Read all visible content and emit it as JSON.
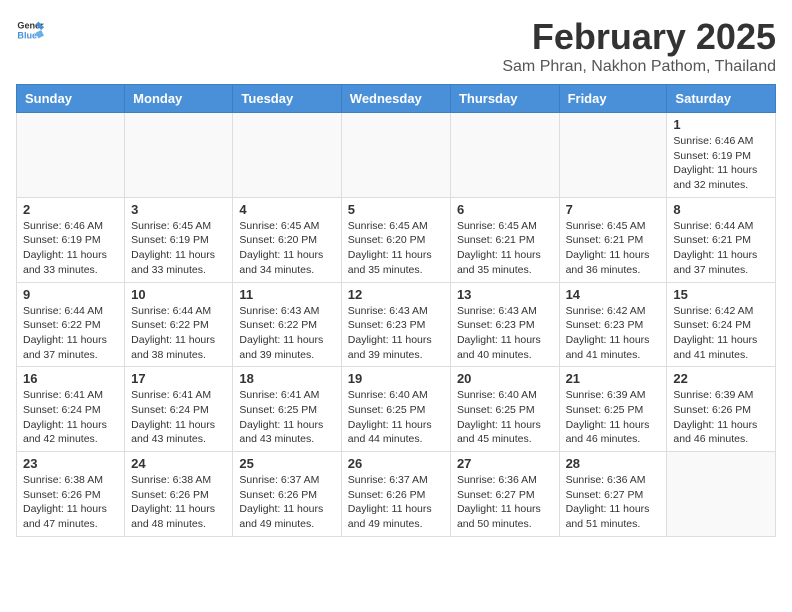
{
  "header": {
    "logo_general": "General",
    "logo_blue": "Blue",
    "title": "February 2025",
    "subtitle": "Sam Phran, Nakhon Pathom, Thailand"
  },
  "weekdays": [
    "Sunday",
    "Monday",
    "Tuesday",
    "Wednesday",
    "Thursday",
    "Friday",
    "Saturday"
  ],
  "weeks": [
    [
      {
        "day": "",
        "info": ""
      },
      {
        "day": "",
        "info": ""
      },
      {
        "day": "",
        "info": ""
      },
      {
        "day": "",
        "info": ""
      },
      {
        "day": "",
        "info": ""
      },
      {
        "day": "",
        "info": ""
      },
      {
        "day": "1",
        "info": "Sunrise: 6:46 AM\nSunset: 6:19 PM\nDaylight: 11 hours and 32 minutes."
      }
    ],
    [
      {
        "day": "2",
        "info": "Sunrise: 6:46 AM\nSunset: 6:19 PM\nDaylight: 11 hours and 33 minutes."
      },
      {
        "day": "3",
        "info": "Sunrise: 6:45 AM\nSunset: 6:19 PM\nDaylight: 11 hours and 33 minutes."
      },
      {
        "day": "4",
        "info": "Sunrise: 6:45 AM\nSunset: 6:20 PM\nDaylight: 11 hours and 34 minutes."
      },
      {
        "day": "5",
        "info": "Sunrise: 6:45 AM\nSunset: 6:20 PM\nDaylight: 11 hours and 35 minutes."
      },
      {
        "day": "6",
        "info": "Sunrise: 6:45 AM\nSunset: 6:21 PM\nDaylight: 11 hours and 35 minutes."
      },
      {
        "day": "7",
        "info": "Sunrise: 6:45 AM\nSunset: 6:21 PM\nDaylight: 11 hours and 36 minutes."
      },
      {
        "day": "8",
        "info": "Sunrise: 6:44 AM\nSunset: 6:21 PM\nDaylight: 11 hours and 37 minutes."
      }
    ],
    [
      {
        "day": "9",
        "info": "Sunrise: 6:44 AM\nSunset: 6:22 PM\nDaylight: 11 hours and 37 minutes."
      },
      {
        "day": "10",
        "info": "Sunrise: 6:44 AM\nSunset: 6:22 PM\nDaylight: 11 hours and 38 minutes."
      },
      {
        "day": "11",
        "info": "Sunrise: 6:43 AM\nSunset: 6:22 PM\nDaylight: 11 hours and 39 minutes."
      },
      {
        "day": "12",
        "info": "Sunrise: 6:43 AM\nSunset: 6:23 PM\nDaylight: 11 hours and 39 minutes."
      },
      {
        "day": "13",
        "info": "Sunrise: 6:43 AM\nSunset: 6:23 PM\nDaylight: 11 hours and 40 minutes."
      },
      {
        "day": "14",
        "info": "Sunrise: 6:42 AM\nSunset: 6:23 PM\nDaylight: 11 hours and 41 minutes."
      },
      {
        "day": "15",
        "info": "Sunrise: 6:42 AM\nSunset: 6:24 PM\nDaylight: 11 hours and 41 minutes."
      }
    ],
    [
      {
        "day": "16",
        "info": "Sunrise: 6:41 AM\nSunset: 6:24 PM\nDaylight: 11 hours and 42 minutes."
      },
      {
        "day": "17",
        "info": "Sunrise: 6:41 AM\nSunset: 6:24 PM\nDaylight: 11 hours and 43 minutes."
      },
      {
        "day": "18",
        "info": "Sunrise: 6:41 AM\nSunset: 6:25 PM\nDaylight: 11 hours and 43 minutes."
      },
      {
        "day": "19",
        "info": "Sunrise: 6:40 AM\nSunset: 6:25 PM\nDaylight: 11 hours and 44 minutes."
      },
      {
        "day": "20",
        "info": "Sunrise: 6:40 AM\nSunset: 6:25 PM\nDaylight: 11 hours and 45 minutes."
      },
      {
        "day": "21",
        "info": "Sunrise: 6:39 AM\nSunset: 6:25 PM\nDaylight: 11 hours and 46 minutes."
      },
      {
        "day": "22",
        "info": "Sunrise: 6:39 AM\nSunset: 6:26 PM\nDaylight: 11 hours and 46 minutes."
      }
    ],
    [
      {
        "day": "23",
        "info": "Sunrise: 6:38 AM\nSunset: 6:26 PM\nDaylight: 11 hours and 47 minutes."
      },
      {
        "day": "24",
        "info": "Sunrise: 6:38 AM\nSunset: 6:26 PM\nDaylight: 11 hours and 48 minutes."
      },
      {
        "day": "25",
        "info": "Sunrise: 6:37 AM\nSunset: 6:26 PM\nDaylight: 11 hours and 49 minutes."
      },
      {
        "day": "26",
        "info": "Sunrise: 6:37 AM\nSunset: 6:26 PM\nDaylight: 11 hours and 49 minutes."
      },
      {
        "day": "27",
        "info": "Sunrise: 6:36 AM\nSunset: 6:27 PM\nDaylight: 11 hours and 50 minutes."
      },
      {
        "day": "28",
        "info": "Sunrise: 6:36 AM\nSunset: 6:27 PM\nDaylight: 11 hours and 51 minutes."
      },
      {
        "day": "",
        "info": ""
      }
    ]
  ]
}
